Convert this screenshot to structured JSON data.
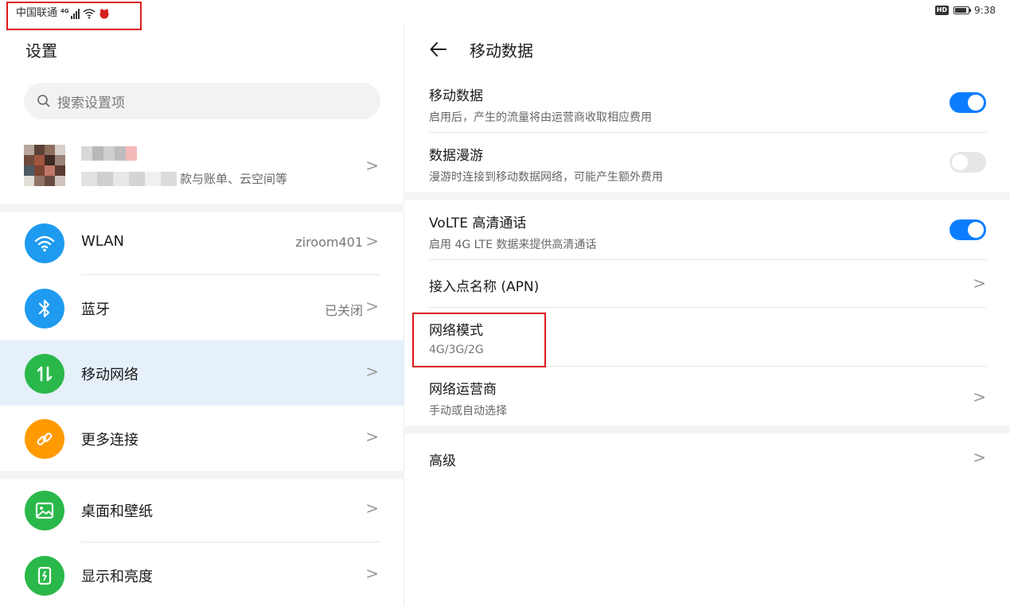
{
  "status_bar": {
    "carrier": "中国联通",
    "network": "4G",
    "hd_badge": "HD",
    "time": "9:38",
    "battery_level": 0.9,
    "icons": [
      "signal-icon",
      "wifi-icon",
      "app-notification-icon",
      "battery-icon"
    ]
  },
  "settings": {
    "title": "设置",
    "search_placeholder": "搜索设置项",
    "account": {
      "subtitle_suffix": "款与账单、云空间等"
    },
    "items": [
      {
        "label": "WLAN",
        "value": "ziroom401",
        "icon": "wifi-icon",
        "color": "#1e9bf0"
      },
      {
        "label": "蓝牙",
        "value": "已关闭",
        "icon": "bluetooth-icon",
        "color": "#1e9bf0"
      },
      {
        "label": "移动网络",
        "value": "",
        "icon": "mobile-data-icon",
        "color": "#2bb84a"
      },
      {
        "label": "更多连接",
        "value": "",
        "icon": "link-icon",
        "color": "#ff9b00"
      },
      {
        "label": "桌面和壁纸",
        "value": "",
        "icon": "image-icon",
        "color": "#2bb84a"
      },
      {
        "label": "显示和亮度",
        "value": "",
        "icon": "display-icon",
        "color": "#2bb84a"
      }
    ],
    "chevron": ">"
  },
  "mobile_data": {
    "title": "移动数据",
    "items": [
      {
        "title": "移动数据",
        "subtitle": "启用后，产生的流量将由运营商收取相应费用",
        "toggle": true
      },
      {
        "title": "数据漫游",
        "subtitle": "漫游时连接到移动数据网络，可能产生额外费用",
        "toggle": false
      },
      {
        "title": "VoLTE 高清通话",
        "subtitle": "启用 4G LTE 数据来提供高清通话",
        "toggle": true
      },
      {
        "title": "接入点名称 (APN)",
        "subtitle": ""
      },
      {
        "title": "网络模式",
        "subtitle": "4G/3G/2G"
      },
      {
        "title": "网络运营商",
        "subtitle": "手动或自动选择"
      },
      {
        "title": "高级",
        "subtitle": ""
      }
    ],
    "chevron": ">"
  },
  "colors": {
    "accent": "#0a7dff",
    "highlight_row": "#e5f0fb",
    "annotation_red": "#e0191d"
  }
}
